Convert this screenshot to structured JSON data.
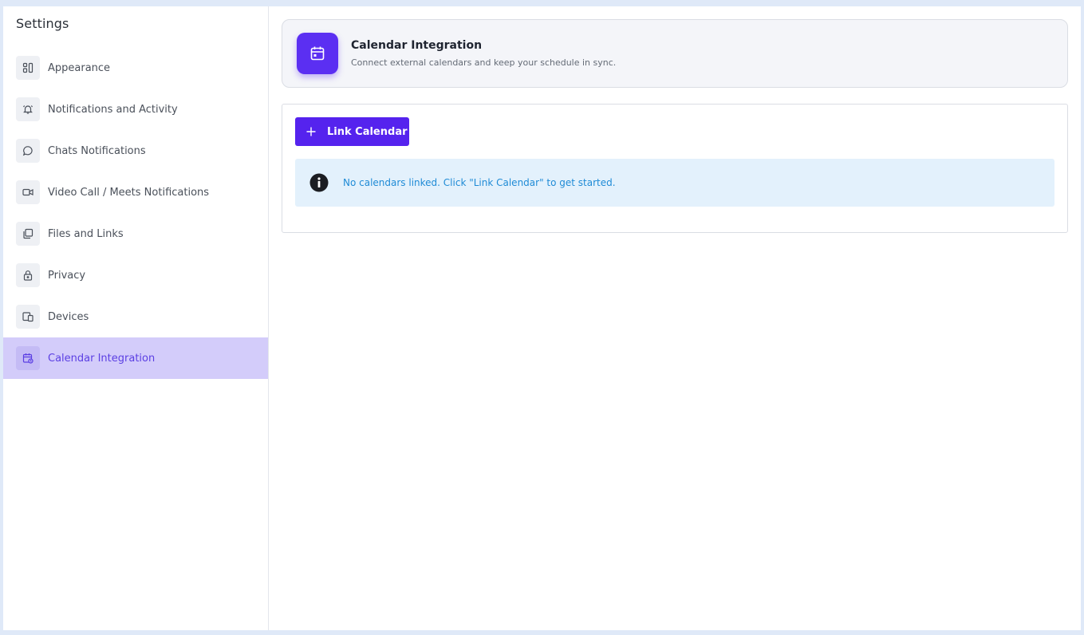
{
  "sidebar": {
    "title": "Settings",
    "items": [
      {
        "label": "Appearance",
        "icon": "appearance-icon",
        "active": false
      },
      {
        "label": "Notifications and Activity",
        "icon": "bell-icon",
        "active": false
      },
      {
        "label": "Chats Notifications",
        "icon": "chat-bubble-icon",
        "active": false
      },
      {
        "label": "Video Call / Meets Notifications",
        "icon": "video-camera-icon",
        "active": false
      },
      {
        "label": "Files and Links",
        "icon": "files-icon",
        "active": false
      },
      {
        "label": "Privacy",
        "icon": "lock-icon",
        "active": false
      },
      {
        "label": "Devices",
        "icon": "devices-icon",
        "active": false
      },
      {
        "label": "Calendar Integration",
        "icon": "calendar-sync-icon",
        "active": true
      }
    ]
  },
  "header": {
    "title": "Calendar Integration",
    "subtitle": "Connect external calendars and keep your schedule in sync.",
    "icon": "calendar-icon"
  },
  "content": {
    "link_button_label": "Link Calendar",
    "info_message": "No calendars linked. Click \"Link Calendar\" to get started."
  },
  "colors": {
    "accent": "#5523ee",
    "active_nav_bg": "#d3ccfa",
    "info_bg": "#e3f1fc",
    "info_text": "#1f8bd6"
  }
}
